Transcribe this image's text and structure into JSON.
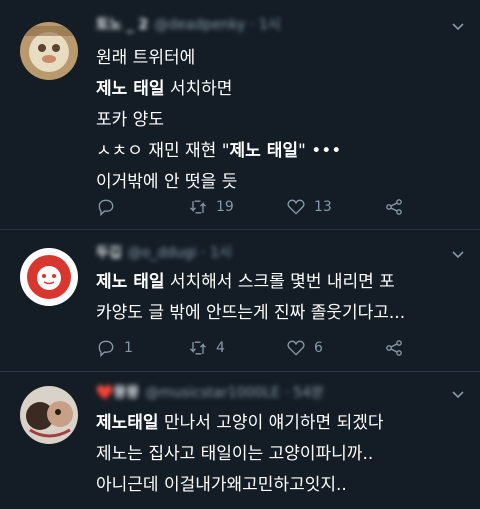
{
  "tweets": [
    {
      "name": "토노 _ 2",
      "handle": "@deadpenky · 1시",
      "lines": [
        [
          {
            "t": "원래 트위터에",
            "b": false
          }
        ],
        [
          {
            "t": "제노 태일",
            "b": true
          },
          {
            "t": " 서치하면",
            "b": false
          }
        ],
        [
          {
            "t": "포카 양도",
            "b": false
          }
        ],
        [
          {
            "t": "ㅅㅊㅇ 재민 재현 \"",
            "b": false
          },
          {
            "t": "제노 태일",
            "b": true
          },
          {
            "t": "\" •••",
            "b": false
          }
        ],
        [
          {
            "t": "이거밖에 안 떳을 듯",
            "b": false
          }
        ]
      ],
      "reply_count": "",
      "retweet_count": "19",
      "like_count": "13"
    },
    {
      "name": "두깁",
      "handle": "@o_ddugi · 1시",
      "lines": [
        [
          {
            "t": "제노 태일",
            "b": true
          },
          {
            "t": " 서치해서 스크롤 몇번 내리면 포",
            "b": false
          }
        ],
        [
          {
            "t": "카양도 글 밖에 안뜨는게 진짜 졸웃기다고...",
            "b": false
          }
        ]
      ],
      "reply_count": "1",
      "retweet_count": "4",
      "like_count": "6"
    },
    {
      "name": "❤️뭉뭉",
      "handle": "@musicstar1000LE · 54분",
      "lines": [
        [
          {
            "t": "제노태일",
            "b": true
          },
          {
            "t": " 만나서 고양이 얘기하면 되겠다",
            "b": false
          }
        ],
        [
          {
            "t": "제노는 집사고 태일이는 고양이파니까..",
            "b": false
          }
        ],
        [
          {
            "t": "아니근데 이걸내가왜고민하고잇지..",
            "b": false
          }
        ]
      ],
      "reply_count": "",
      "retweet_count": "",
      "like_count": ""
    }
  ],
  "icons": {
    "reply": "reply-icon",
    "retweet": "retweet-icon",
    "like": "heart-icon",
    "share": "share-icon",
    "menu": "chevron-down-icon"
  },
  "colors": {
    "background": "#141d26",
    "muted": "#8899a6",
    "divider": "#2a3745"
  }
}
